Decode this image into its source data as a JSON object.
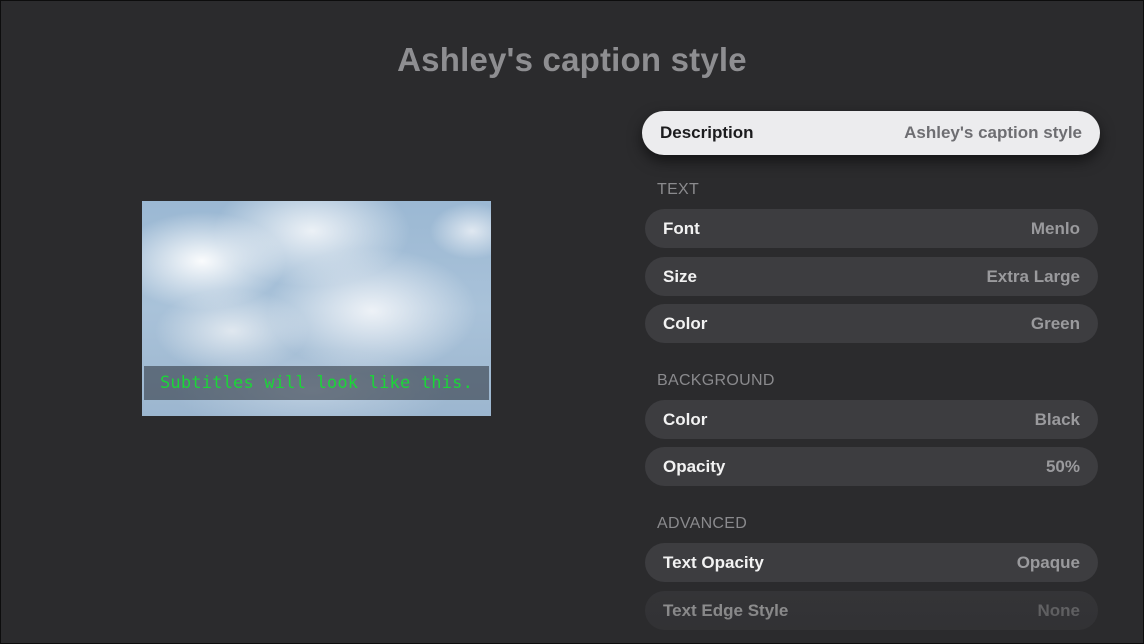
{
  "page_title": "Ashley's caption style",
  "preview": {
    "subtitle_text": "Subtitles will look like this.",
    "subtitle_color": "#1bd638"
  },
  "settings": {
    "description": {
      "label": "Description",
      "value": "Ashley's caption style"
    },
    "text_section": {
      "header": "TEXT",
      "font": {
        "label": "Font",
        "value": "Menlo"
      },
      "size": {
        "label": "Size",
        "value": "Extra Large"
      },
      "color": {
        "label": "Color",
        "value": "Green"
      }
    },
    "background_section": {
      "header": "BACKGROUND",
      "color": {
        "label": "Color",
        "value": "Black"
      },
      "opacity": {
        "label": "Opacity",
        "value": "50%"
      }
    },
    "advanced_section": {
      "header": "ADVANCED",
      "text_opacity": {
        "label": "Text Opacity",
        "value": "Opaque"
      },
      "text_edge_style": {
        "label": "Text Edge Style",
        "value": "None"
      }
    }
  }
}
